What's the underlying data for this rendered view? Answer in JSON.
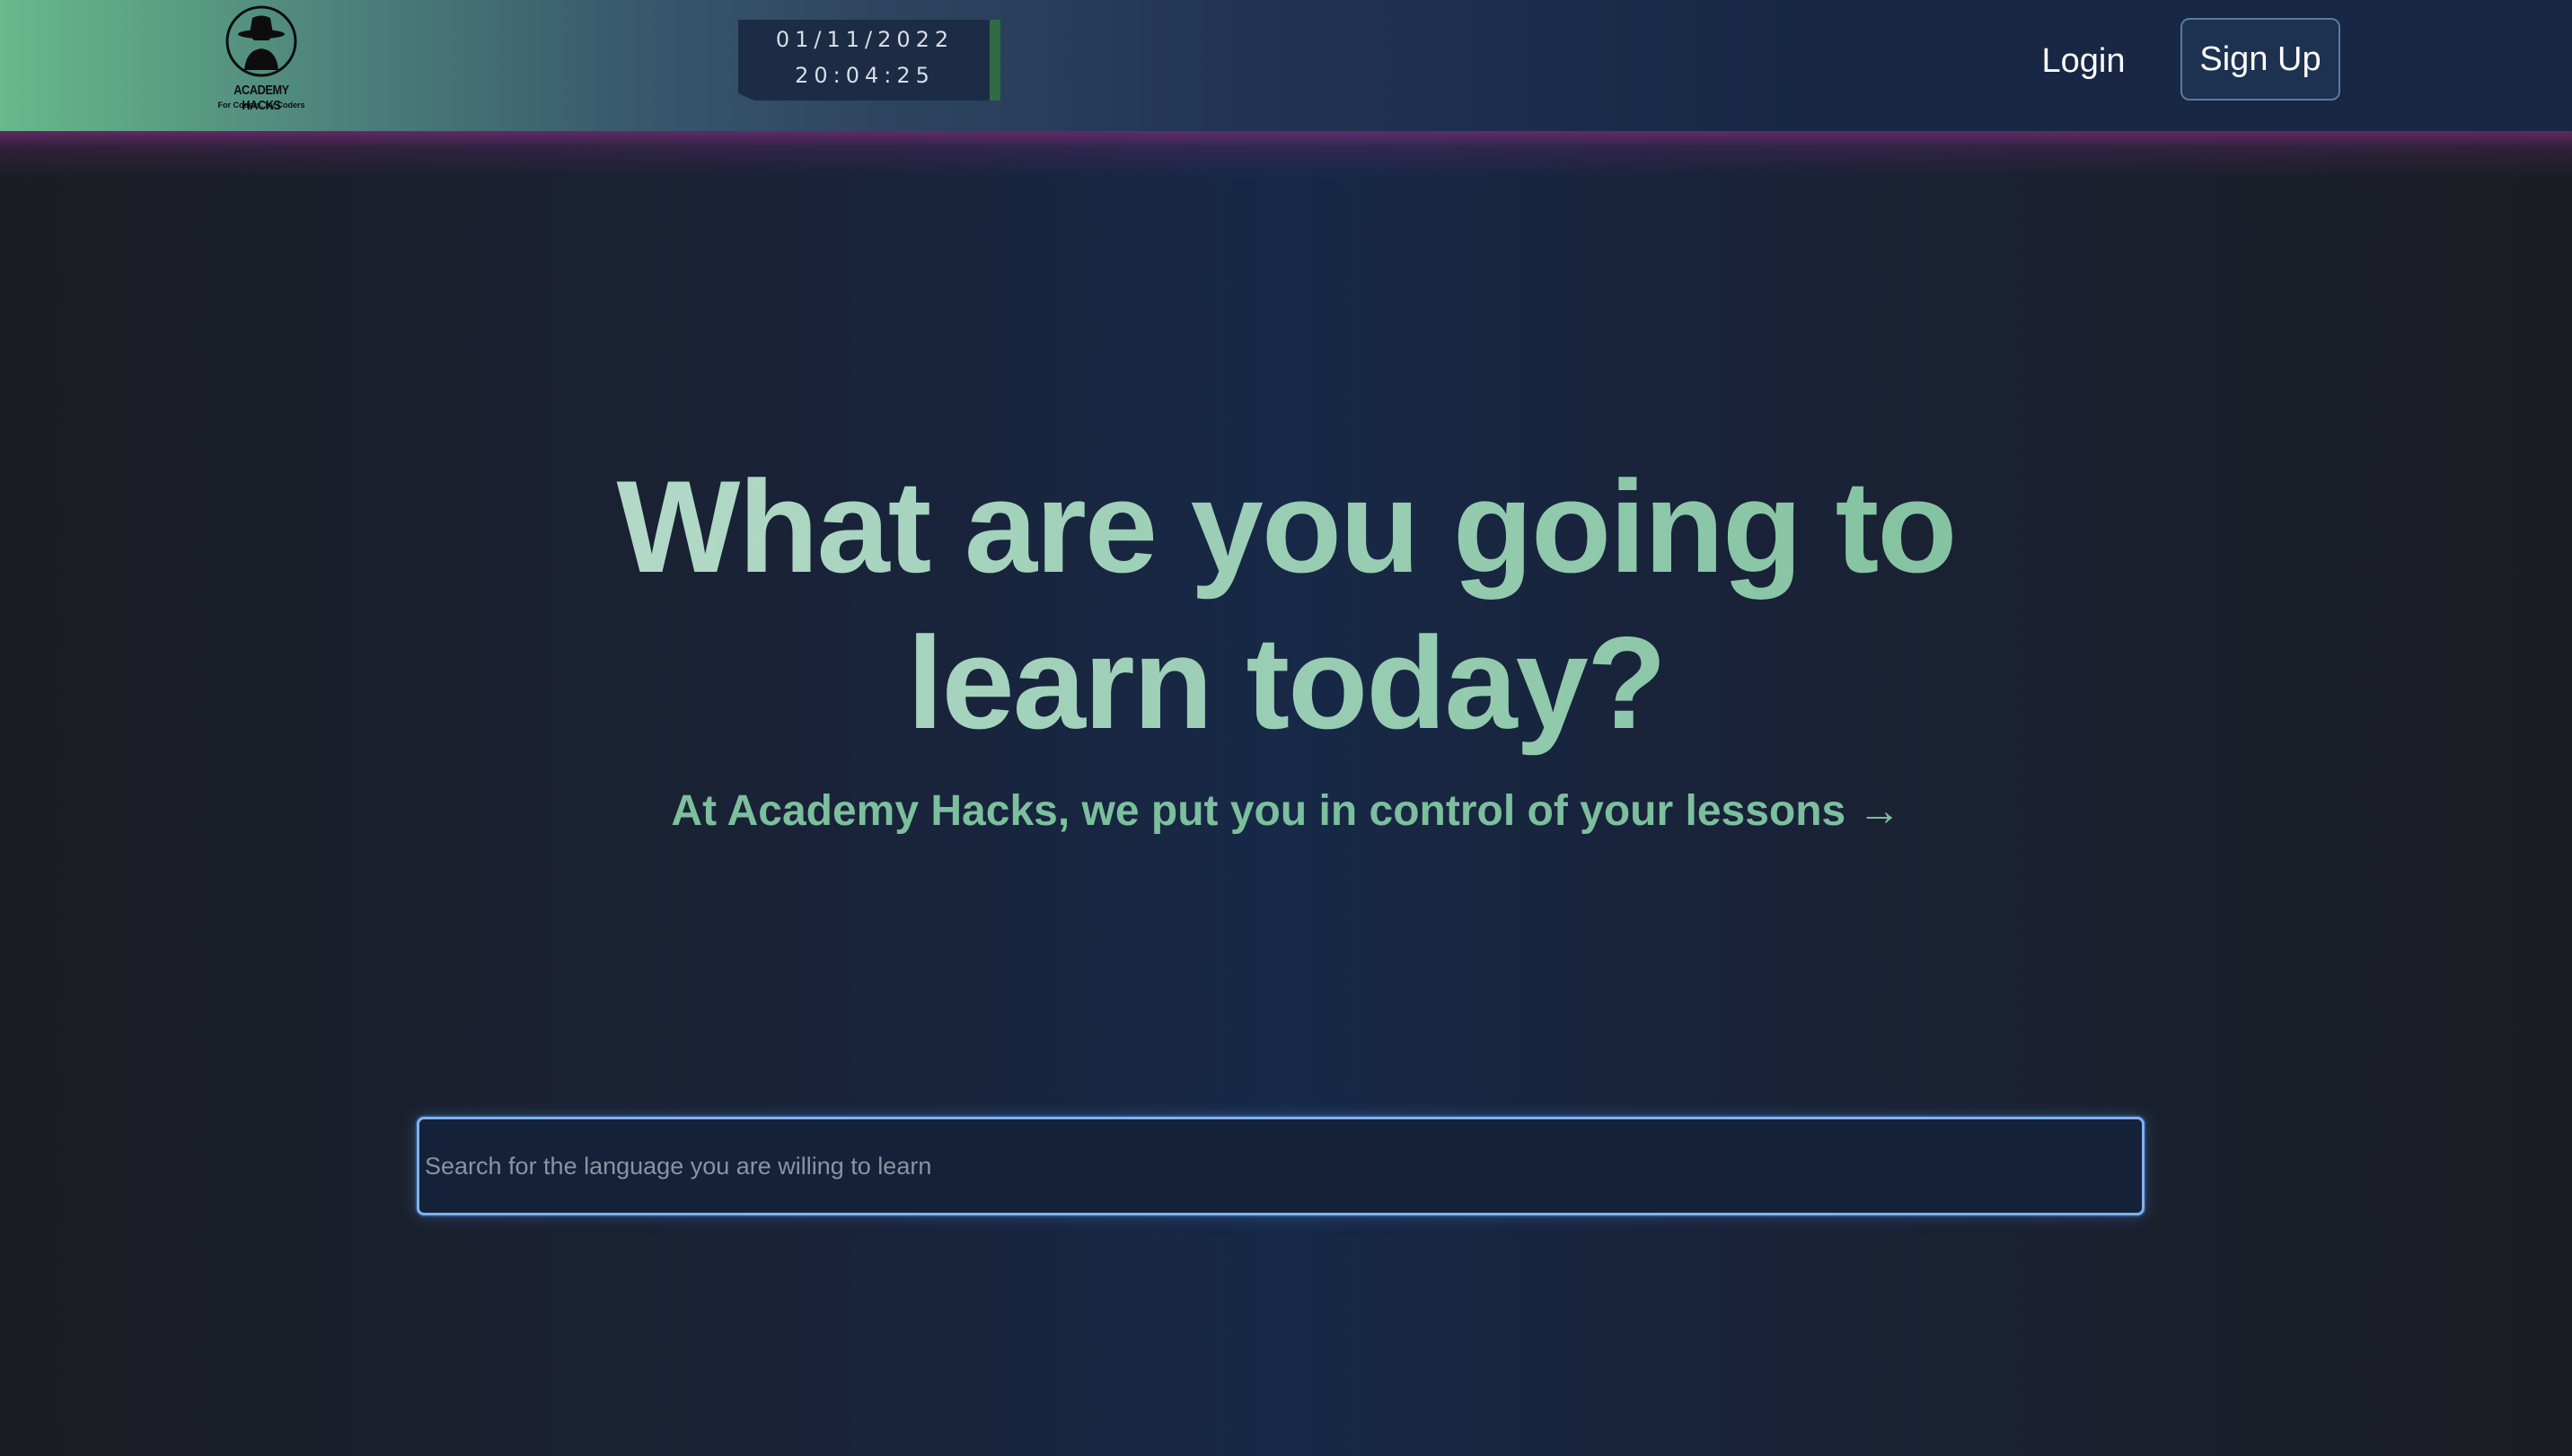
{
  "header": {
    "logo": {
      "name": "ACADEMY HACKS",
      "tagline": "For Coders, by Coders"
    },
    "clock": {
      "date": "01/11/2022",
      "time": "20:04:25"
    },
    "login_label": "Login",
    "signup_label": "Sign Up"
  },
  "hero": {
    "title": "What are you going to learn today?",
    "subtitle": "At Academy Hacks, we put you in control of your lessons →"
  },
  "search": {
    "placeholder": "Search for the language you are willing to learn",
    "value": ""
  },
  "colors": {
    "accent_green": "#7cbf9d",
    "navbar_left": "#68b98b",
    "navbar_right": "#172744",
    "glow_purple": "#782d78",
    "search_border": "#7fb2ee"
  }
}
